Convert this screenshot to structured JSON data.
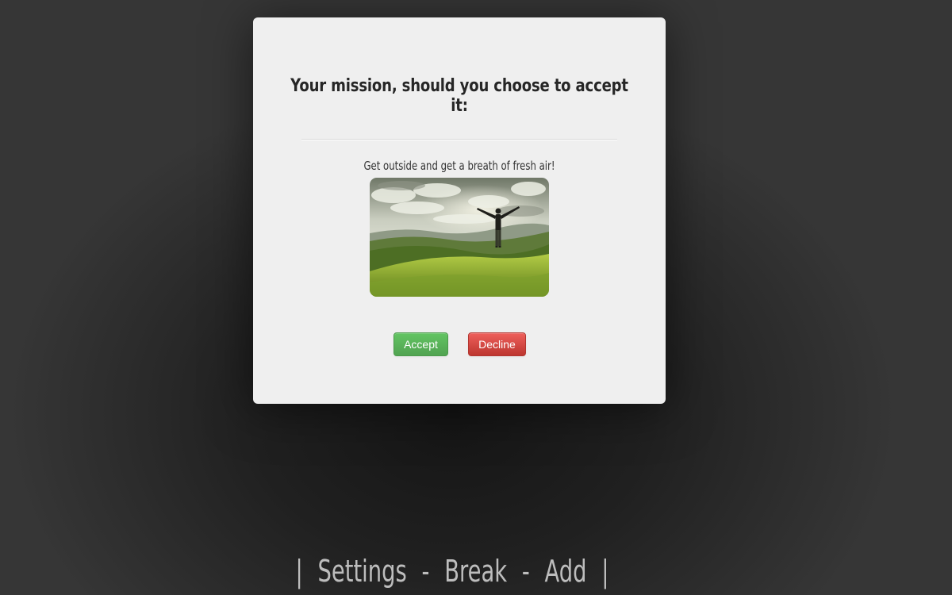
{
  "modal": {
    "title": "Your mission, should you choose to accept it:",
    "message": "Get outside and get a breath of fresh air!",
    "image_subject": "person with raised arms on a grassy hilltop overlooking green hills under a cloudy sky",
    "accept_label": "Accept",
    "decline_label": "Decline"
  },
  "bottom_nav": {
    "left_bar": "|",
    "settings_label": "Settings",
    "dash_1": "-",
    "break_label": "Break",
    "dash_2": "-",
    "add_label": "Add",
    "right_bar": "|"
  },
  "colors": {
    "accept": "#5bb75b",
    "decline": "#da4f49",
    "modal_background": "#efefef",
    "page_background": "#2e2e2e"
  }
}
